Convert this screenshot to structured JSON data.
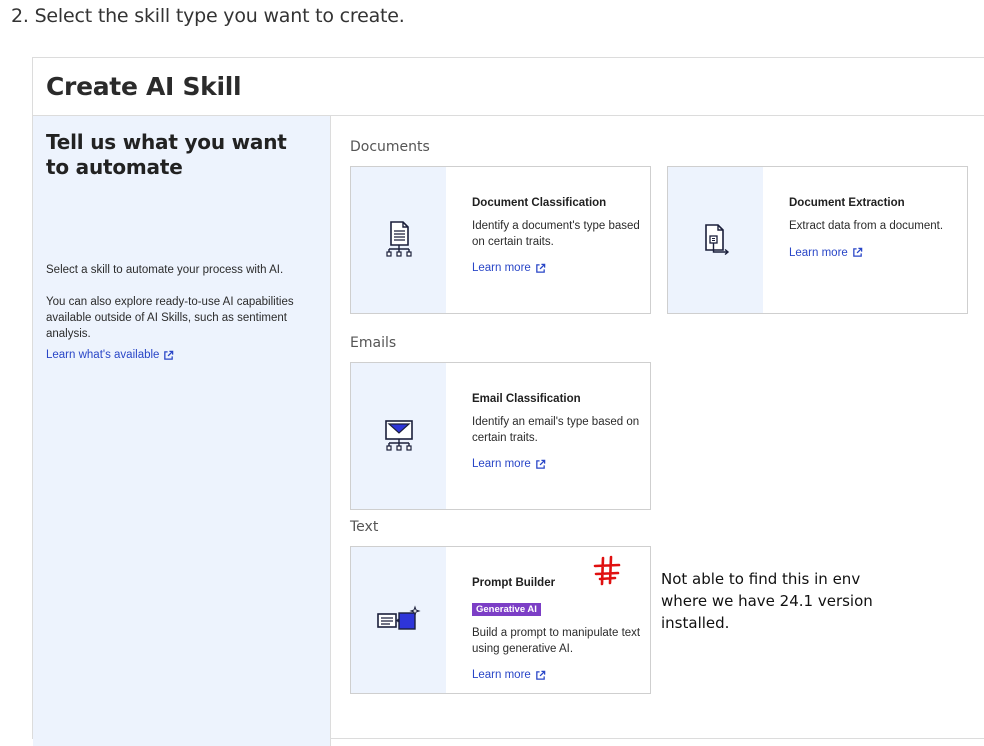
{
  "step_caption": "2. Select the skill type you want to create.",
  "panel": {
    "title": "Create AI Skill"
  },
  "sidebar": {
    "heading": "Tell us what you want to automate",
    "text_1": "Select a skill to automate your process with AI.",
    "text_2": "You can also explore ready-to-use AI capabilities available outside of AI Skills, such as sentiment analysis.",
    "link": "Learn what's available"
  },
  "sections": {
    "documents": "Documents",
    "emails": "Emails",
    "text": "Text"
  },
  "cards": {
    "doc_classification": {
      "title": "Document Classification",
      "desc": "Identify a document's type based on certain traits.",
      "link": "Learn more"
    },
    "doc_extraction": {
      "title": "Document Extraction",
      "desc": "Extract data from a document.",
      "link": "Learn more"
    },
    "email_classification": {
      "title": "Email Classification",
      "desc": "Identify an email's type based on certain traits.",
      "link": "Learn more"
    },
    "prompt_builder": {
      "title": "Prompt Builder",
      "badge": "Generative AI",
      "desc": "Build a prompt to manipulate text using generative AI.",
      "link": "Learn more"
    }
  },
  "annotation": {
    "text": "Not able to find this in env where we have 24.1 version installed."
  },
  "colors": {
    "accent_link": "#2946c7",
    "icon_area_bg": "#edf3fd",
    "badge_bg": "#7c3ec6",
    "annotation_mark": "#e01010"
  }
}
